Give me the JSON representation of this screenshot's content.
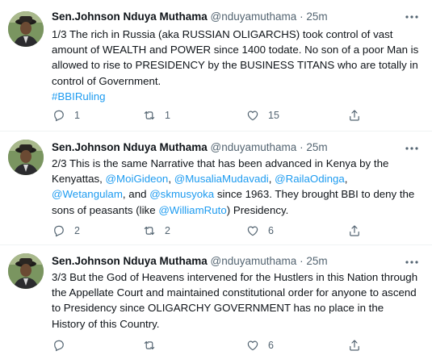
{
  "tweets": [
    {
      "display_name": "Sen.Johnson Nduya Muthama",
      "handle": "@nduyamuthama",
      "separator": "·",
      "time": "25m",
      "text_parts": [
        {
          "t": "1/3 The rich in Russia (aka RUSSIAN OLIGARCHS) took control of vast amount of WEALTH and POWER since 1400 todate. No son of a poor Man is allowed to rise to PRESIDENCY by the BUSINESS TITANS who are totally in control of Government.",
          "link": false
        },
        {
          "t": "#BBIRuling",
          "link": true
        }
      ],
      "reply_count": "1",
      "retweet_count": "1",
      "like_count": "15",
      "share_count": ""
    },
    {
      "display_name": "Sen.Johnson Nduya Muthama",
      "handle": "@nduyamuthama",
      "separator": "·",
      "time": "25m",
      "text_parts": [
        {
          "t": "2/3 This is the same Narrative that has been advanced in Kenya by the Kenyattas,  ",
          "link": false
        },
        {
          "t": "@MoiGideon",
          "link": true
        },
        {
          "t": ", ",
          "link": false
        },
        {
          "t": "@MusaliaMudavadi",
          "link": true
        },
        {
          "t": ", ",
          "link": false
        },
        {
          "t": "@RailaOdinga",
          "link": true
        },
        {
          "t": ", ",
          "link": false
        },
        {
          "t": "@Wetangulam",
          "link": true
        },
        {
          "t": ", and ",
          "link": false
        },
        {
          "t": "@skmusyoka",
          "link": true
        },
        {
          "t": " since 1963. They brought BBI to deny the sons of peasants (like ",
          "link": false
        },
        {
          "t": "@WilliamRuto",
          "link": true
        },
        {
          "t": ") Presidency.",
          "link": false
        }
      ],
      "reply_count": "2",
      "retweet_count": "2",
      "like_count": "6",
      "share_count": ""
    },
    {
      "display_name": "Sen.Johnson Nduya Muthama",
      "handle": "@nduyamuthama",
      "separator": "·",
      "time": "25m",
      "text_parts": [
        {
          "t": "3/3 But the God of Heavens intervened for the Hustlers in this Nation through the Appellate Court and maintained constitutional order for anyone to ascend to Presidency since OLIGARCHY GOVERNMENT has no place in the History of this Country.",
          "link": false
        }
      ],
      "reply_count": "",
      "retweet_count": "",
      "like_count": "6",
      "share_count": ""
    }
  ],
  "colors": {
    "text": "#0f1419",
    "secondary": "#536471",
    "link": "#1d9bf0",
    "divider": "#eff3f4"
  },
  "icons": [
    "reply-icon",
    "retweet-icon",
    "like-icon",
    "share-icon",
    "more-options-icon"
  ]
}
